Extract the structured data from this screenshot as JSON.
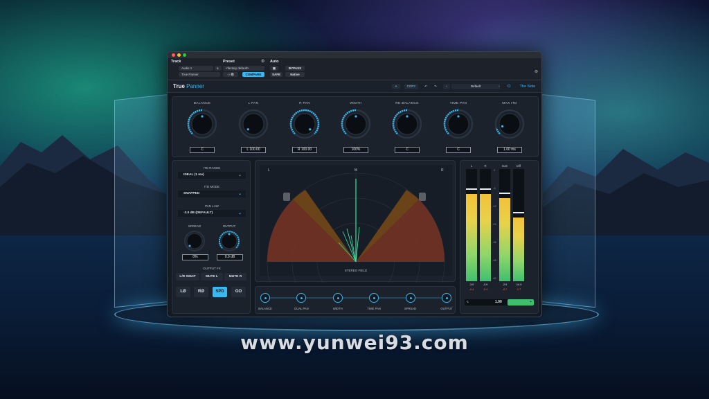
{
  "watermark": "www.yunwei93.com",
  "host": {
    "track_label": "Track",
    "track_name": "Audio 1",
    "track_channel": "a",
    "plugin_name": "True Panner",
    "preset_label": "Preset",
    "preset_value": "<factory default>",
    "compare_label": "COMPARE",
    "auto_label": "Auto",
    "bypass_label": "BYPASS",
    "safe_label": "SAFE",
    "native_label": "Native"
  },
  "plugin": {
    "brand_true": "True",
    "brand_panner": "Panner",
    "ab_label": "A",
    "copy_label": "COPY",
    "preset_name": "Default",
    "vendor": "The Note"
  },
  "knobs": [
    {
      "label": "BALANCE",
      "value": "C",
      "level": 0.5
    },
    {
      "label": "L PAN",
      "value": "L 100.00",
      "level": 0.0
    },
    {
      "label": "R PAN",
      "value": "R 100.00",
      "level": 1.0
    },
    {
      "label": "WIDTH",
      "value": "100%",
      "level": 0.5
    },
    {
      "label": "RE BALANCE",
      "value": "C",
      "level": 0.5
    },
    {
      "label": "TIME PAN",
      "value": "C",
      "level": 0.5
    },
    {
      "label": "MAX ITD",
      "value": "1.00 ms",
      "level": 0.1
    }
  ],
  "left": {
    "itd_range_label": "ITD RANGE",
    "itd_range_value": "IDEAL (1 ms)",
    "itd_mode_label": "ITD MODE",
    "itd_mode_value": "SNAPPED",
    "pan_law_label": "PAN LAW",
    "pan_law_value": "-3.0 dB (DEFAULT)",
    "spread_label": "SPREAD",
    "spread_value": "0%",
    "output_label": "OUTPUT",
    "output_value": "0.0 dB",
    "output_fx_label": "OUTPUT FX",
    "lr_swap_label": "L/R SWAP",
    "mute_l_label": "MUTE L",
    "mute_r_label": "MUTE R",
    "l_phase_label": "LØ",
    "r_phase_label": "RØ",
    "spd_label": "SPD",
    "go_label": "GO"
  },
  "field": {
    "title": "STEREO FIELD",
    "l_marker": "L",
    "m_marker": "M",
    "r_marker": "R"
  },
  "chain": [
    "BALANCE",
    "DUAL PAN",
    "WIDTH",
    "TIME PAN",
    "SPREAD",
    "OUTPUT"
  ],
  "meters": {
    "channels": [
      {
        "label": "L",
        "level": 0.78,
        "peak": "-3.0",
        "peak2": "-0.4"
      },
      {
        "label": "R",
        "level": 0.78,
        "peak": "-3.9",
        "peak2": "-0.4"
      },
      {
        "label": "Sum",
        "level": 0.74,
        "peak": "-2.9",
        "peak2": "-0.7"
      },
      {
        "label": "Diff",
        "level": 0.57,
        "peak": "-14.0",
        "peak2": "-1.7"
      }
    ],
    "scale": [
      "0",
      "-6",
      "-12",
      "-24",
      "-36",
      "-48",
      "-60"
    ],
    "fader_min": "-1",
    "fader_value": "1.00",
    "fader_plus": "+"
  },
  "colors": {
    "accent": "#38b8f0",
    "meter_green": "#3fbf6e",
    "meter_yellow": "#f2c23a"
  }
}
